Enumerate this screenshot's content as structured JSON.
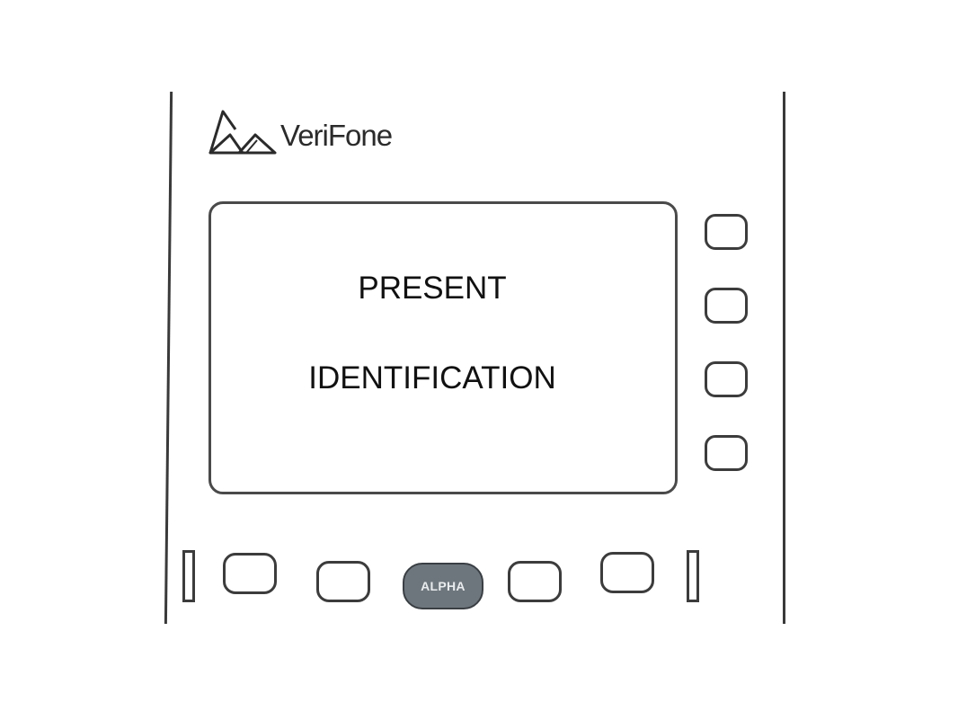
{
  "brand": {
    "name": "VeriFone",
    "logo_icon": "verifone-triangle-logo"
  },
  "screen": {
    "line1": "PRESENT",
    "line2": "IDENTIFICATION"
  },
  "keys": {
    "alpha_label": "ALPHA"
  }
}
